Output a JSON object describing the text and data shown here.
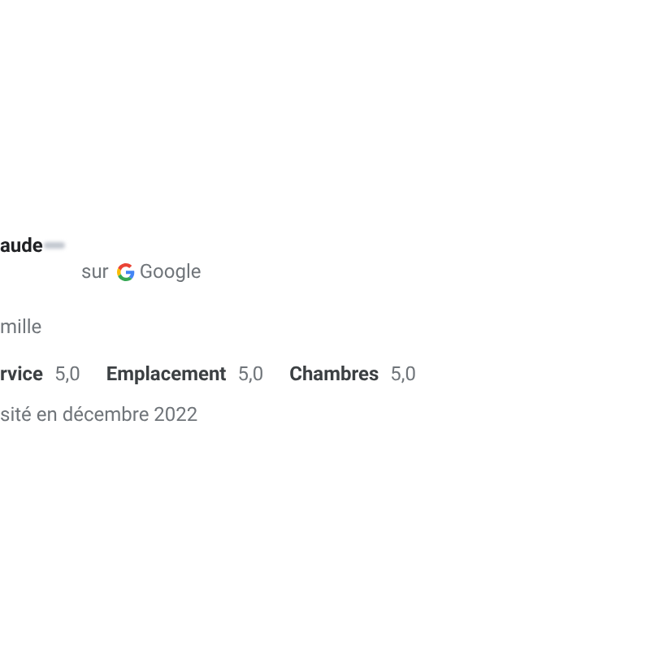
{
  "author": {
    "name": "aude",
    "source_prefix": "sur",
    "source": "Google"
  },
  "trip_type": "mille",
  "ratings": [
    {
      "label": "rvice",
      "value": "5,0"
    },
    {
      "label": "Emplacement",
      "value": "5,0"
    },
    {
      "label": "Chambres",
      "value": "5,0"
    }
  ],
  "visit": "sité en décembre 2022"
}
